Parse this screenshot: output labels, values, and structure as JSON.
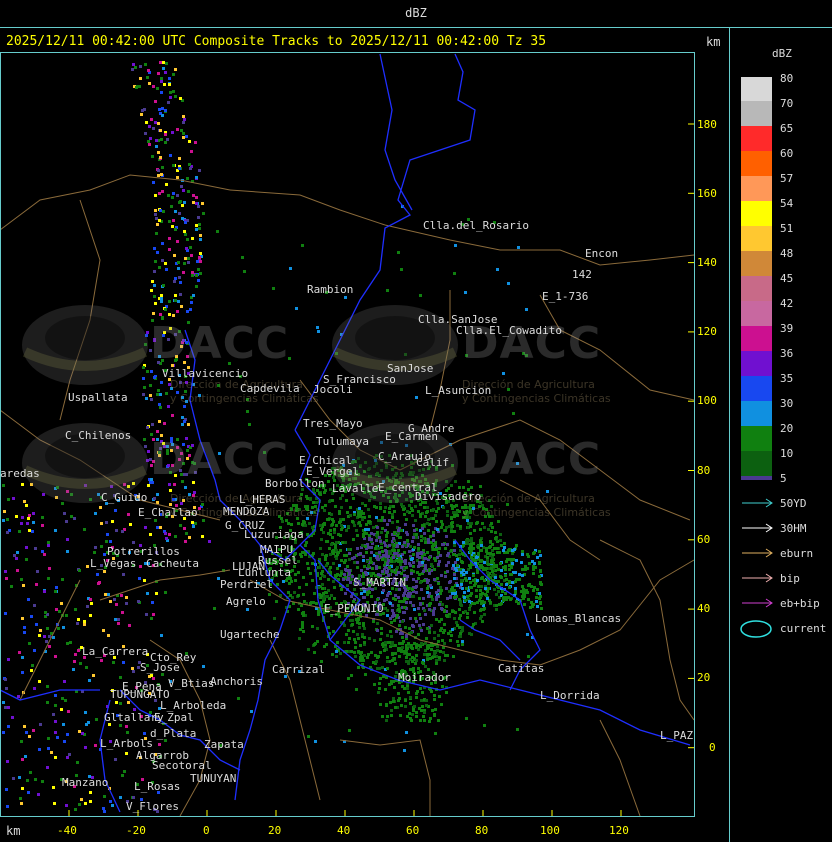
{
  "header": {
    "title": "dBZ"
  },
  "map": {
    "title": "2025/12/11 00:42:00 UTC Composite Tracks to 2025/12/11 00:42:00 Tz 35",
    "units_label": "km",
    "y_ticks": [
      "180",
      "160",
      "140",
      "120",
      "100",
      "80",
      "60",
      "40",
      "20",
      "0"
    ],
    "x_ticks": [
      "-40",
      "-20",
      "0",
      "20",
      "40",
      "60",
      "80",
      "100",
      "120"
    ],
    "colors": {
      "border": "#66cccc",
      "axis_text": "#ffff00",
      "province_line": "#1f2fff",
      "road_line": "#8a6a3a"
    },
    "places": [
      "Clla.del_Rosario",
      "Encon",
      "142",
      "E_1-736",
      "Rambion",
      "Clla.SanJose",
      "Clla.El_Cowadito",
      "Villavicencio",
      "Capdevila",
      "S_Francisco",
      "Jocoli",
      "SanJose",
      "L_Asuncion",
      "Uspallata",
      "Tres_Mayo",
      "G_Andre",
      "E_Carmen",
      "C_Chilenos",
      "Tulumaya",
      "C_Araujo",
      "Calif",
      "E_Chical",
      "E_Vergel",
      "Borbollon",
      "Lavalle",
      "E_central",
      "Divisadero",
      "C_Guido",
      "L_HERAS",
      "MENDOZA",
      "E_Challao",
      "G_CRUZ",
      "Luzuriaga",
      "Potrerillos",
      "L_Vegas",
      "Cacheuta",
      "MAIPU",
      "Russel",
      "LUJAN",
      "Lunlunta",
      "Perdriel",
      "S_MARTIN",
      "Agrelo",
      "Ugarteche",
      "E_PENONIO",
      "Lomas_Blancas",
      "La_Carrera",
      "Cto_Rey",
      "S_Jose",
      "Carrizal",
      "E_Pena",
      "V_Btias",
      "TUPUNGATO",
      "Anchoris",
      "L_Arboleda",
      "Gltallary",
      "E_Zpal",
      "Catitas",
      "L_Dorrida",
      "Moirador",
      "L_Arbols",
      "d_Plata",
      "L_PAZ",
      "Zapata",
      "Algarrob",
      "Secotoral",
      "Manzano",
      "TUNUYAN",
      "L_Rosas",
      "V_Flores",
      "aredas"
    ]
  },
  "watermarks": {
    "brand": "DACC",
    "subtitle_line1": "Dirección de Agricultura",
    "subtitle_line2": "y Contingencias Climáticas"
  },
  "legend": {
    "title": "dBZ",
    "scale": [
      {
        "label": "80",
        "color": "#d8d8d8"
      },
      {
        "label": "70",
        "color": "#b8b8b8"
      },
      {
        "label": "65",
        "color": "#ff2a2a"
      },
      {
        "label": "60",
        "color": "#ff6000"
      },
      {
        "label": "57",
        "color": "#ff9858"
      },
      {
        "label": "54",
        "color": "#ffff00"
      },
      {
        "label": "51",
        "color": "#ffc830"
      },
      {
        "label": "48",
        "color": "#d08838"
      },
      {
        "label": "45",
        "color": "#c86a88"
      },
      {
        "label": "42",
        "color": "#c868a0"
      },
      {
        "label": "39",
        "color": "#cc1090"
      },
      {
        "label": "36",
        "color": "#7010d0"
      },
      {
        "label": "35",
        "color": "#1848f0"
      },
      {
        "label": "30",
        "color": "#1090e0"
      },
      {
        "label": "20",
        "color": "#108010"
      },
      {
        "label": "10",
        "color": "#0c6010"
      },
      {
        "label": "5",
        "color": "#4a3a90"
      }
    ],
    "tracks": [
      {
        "label": "50YD",
        "color": "#40d0d0"
      },
      {
        "label": "30HM",
        "color": "#ffffff"
      },
      {
        "label": "eburn",
        "color": "#e0b060"
      },
      {
        "label": "bip",
        "color": "#f0b0b0"
      },
      {
        "label": "eb+bip",
        "color": "#d040d0"
      }
    ],
    "current": {
      "label": "current",
      "color": "#30e0e0"
    }
  }
}
